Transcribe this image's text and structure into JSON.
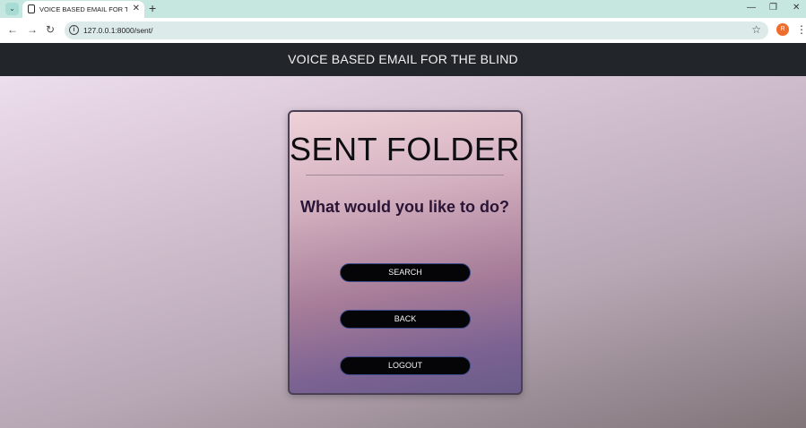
{
  "browser": {
    "tab_title": "VOICE BASED EMAIL FOR THE B",
    "tab_close": "✕",
    "new_tab": "+",
    "url": "127.0.0.1:8000/sent/",
    "profile_initial": "R",
    "icons": [
      "tab-search-icon",
      "favicon-icon",
      "back-icon",
      "forward-icon",
      "reload-icon",
      "info-icon",
      "star-icon",
      "menu-icon",
      "minimize-icon",
      "restore-icon",
      "close-window-icon"
    ]
  },
  "navbar": {
    "title": "VOICE BASED EMAIL FOR THE BLIND"
  },
  "card": {
    "title": "SENT FOLDER",
    "question": "What would you like to do?",
    "buttons": {
      "search": "SEARCH",
      "back": "BACK",
      "logout": "LOGOUT"
    }
  },
  "colors": {
    "navbar_bg": "#22252a",
    "button_bg": "#050508",
    "button_border": "#3a4a8a",
    "title_text": "#0d0d12",
    "question_text": "#2a1436"
  }
}
